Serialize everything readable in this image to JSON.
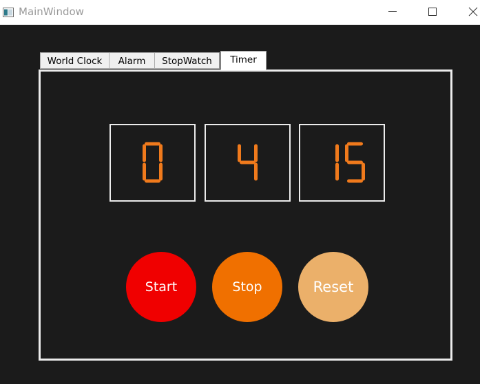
{
  "window": {
    "title": "MainWindow"
  },
  "tabs": [
    {
      "label": "World Clock",
      "selected": false
    },
    {
      "label": "Alarm",
      "selected": false
    },
    {
      "label": "StopWatch",
      "selected": false
    },
    {
      "label": "Timer",
      "selected": true
    }
  ],
  "timer": {
    "hours": "0",
    "minutes": "4",
    "seconds": "15",
    "digit_color": "#f07a1c"
  },
  "buttons": {
    "start": {
      "label": "Start",
      "color": "#f00000"
    },
    "stop": {
      "label": "Stop",
      "color": "#f07000"
    },
    "reset": {
      "label": "Reset",
      "color": "#ebb06a"
    }
  },
  "colors": {
    "window_background": "#1b1b1b",
    "panel_border": "#ececec"
  }
}
